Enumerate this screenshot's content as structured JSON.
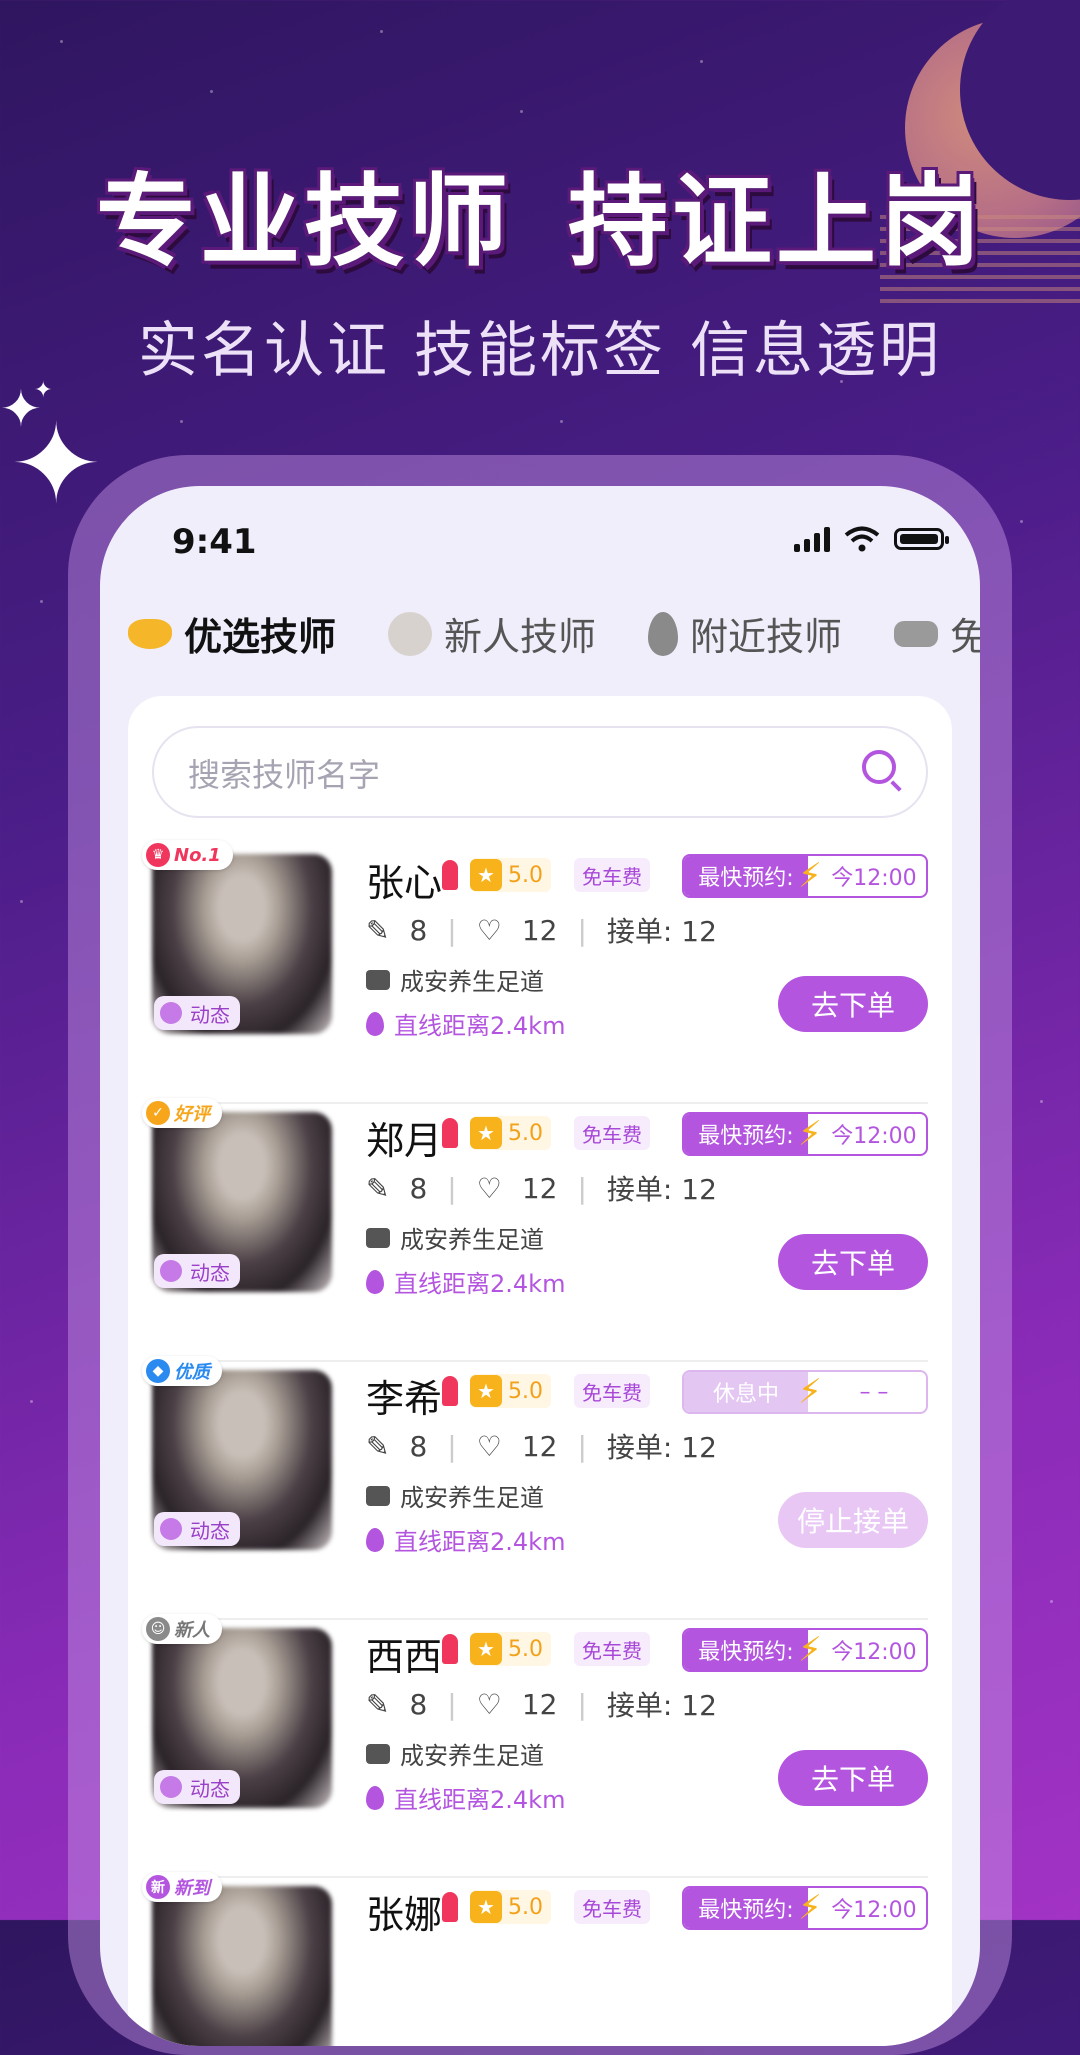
{
  "banner": {
    "headline_left": "专业技师",
    "headline_right": "持证上岗",
    "sub_items": [
      "实名认证",
      "技能标签",
      "信息透明"
    ]
  },
  "status_bar": {
    "time": "9:41"
  },
  "tabs": [
    {
      "label": "优选技师",
      "icon": "crown-icon",
      "active": true
    },
    {
      "label": "新人技师",
      "icon": "person-icon",
      "active": false
    },
    {
      "label": "附近技师",
      "icon": "location-pin-icon",
      "active": false
    },
    {
      "label": "免",
      "icon": "car-icon",
      "active": false
    }
  ],
  "search": {
    "placeholder": "搜索技师名字"
  },
  "technicians": [
    {
      "rank_badge": "No.1",
      "rank_color": "#f0365d",
      "name": "张心",
      "score": "5.0",
      "fee": "免车费",
      "appoint_label": "最快预约:",
      "appoint_time": "今12:00",
      "edits": "8",
      "likes": "12",
      "orders": "接单: 12",
      "shop": "成安养生足道",
      "distance": "直线距离2.4km",
      "dynamic": "动态",
      "button": "去下单",
      "resting": false
    },
    {
      "rank_badge": "好评",
      "rank_color": "#f7a61c",
      "name": "郑月",
      "score": "5.0",
      "fee": "免车费",
      "appoint_label": "最快预约:",
      "appoint_time": "今12:00",
      "edits": "8",
      "likes": "12",
      "orders": "接单: 12",
      "shop": "成安养生足道",
      "distance": "直线距离2.4km",
      "dynamic": "动态",
      "button": "去下单",
      "resting": false
    },
    {
      "rank_badge": "优质",
      "rank_color": "#2a8af0",
      "name": "李希",
      "score": "5.0",
      "fee": "免车费",
      "appoint_label": "休息中",
      "appoint_time": "– –",
      "edits": "8",
      "likes": "12",
      "orders": "接单: 12",
      "shop": "成安养生足道",
      "distance": "直线距离2.4km",
      "dynamic": "动态",
      "button": "停止接单",
      "resting": true
    },
    {
      "rank_badge": "新人",
      "rank_color": "#8a8a8a",
      "name": "西西",
      "score": "5.0",
      "fee": "免车费",
      "appoint_label": "最快预约:",
      "appoint_time": "今12:00",
      "edits": "8",
      "likes": "12",
      "orders": "接单: 12",
      "shop": "成安养生足道",
      "distance": "直线距离2.4km",
      "dynamic": "动态",
      "button": "去下单",
      "resting": false
    },
    {
      "rank_badge": "新到",
      "rank_color": "#b455e0",
      "name": "张娜",
      "score": "5.0",
      "fee": "免车费",
      "appoint_label": "最快预约:",
      "appoint_time": "今12:00",
      "edits": "",
      "likes": "",
      "orders": "",
      "shop": "",
      "distance": "",
      "dynamic": "",
      "button": "",
      "resting": false
    }
  ],
  "colors": {
    "accent": "#b455e0",
    "gold": "#f7b21c",
    "gender": "#f0365d"
  }
}
